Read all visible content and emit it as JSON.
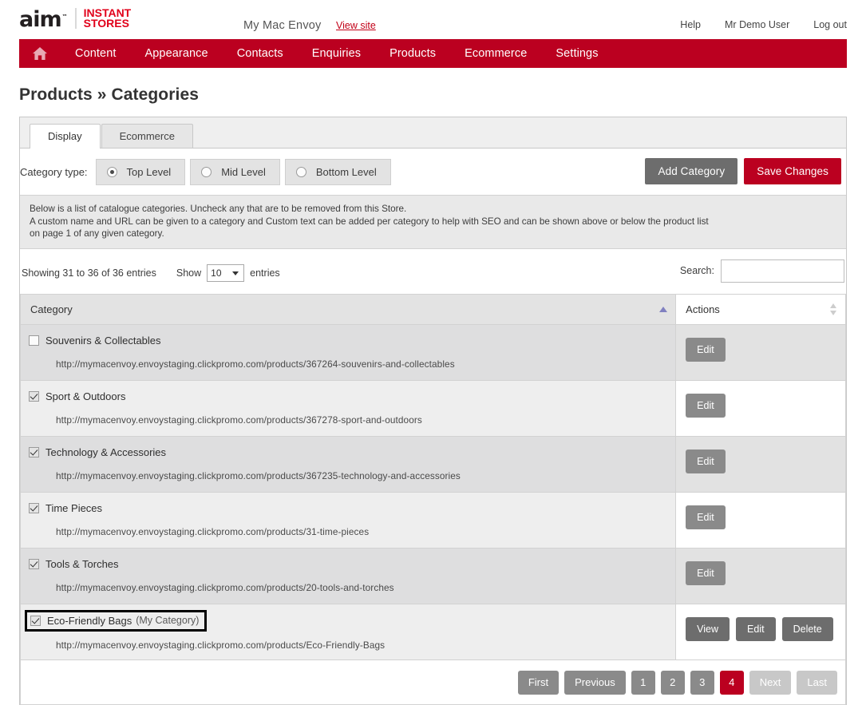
{
  "brand": {
    "logo_primary": "aim",
    "logo_tm": "™",
    "logo_secondary_line1": "INSTANT",
    "logo_secondary_line2": "STORES",
    "accent_red": "#bb0020",
    "logo_red": "#e1001a"
  },
  "topbar": {
    "site_name": "My Mac Envoy",
    "view_site": "View site",
    "links": [
      {
        "label": "Help"
      },
      {
        "label": "Mr Demo User"
      },
      {
        "label": "Log out"
      }
    ]
  },
  "nav": {
    "home_icon": "home-icon",
    "items": [
      {
        "label": "Content"
      },
      {
        "label": "Appearance"
      },
      {
        "label": "Contacts"
      },
      {
        "label": "Enquiries"
      },
      {
        "label": "Products"
      },
      {
        "label": "Ecommerce"
      },
      {
        "label": "Settings"
      }
    ]
  },
  "page": {
    "title": "Products » Categories"
  },
  "tabs": [
    {
      "label": "Display",
      "active": true
    },
    {
      "label": "Ecommerce",
      "active": false
    }
  ],
  "category_type": {
    "label": "Category type:",
    "options": [
      {
        "label": "Top Level",
        "selected": true
      },
      {
        "label": "Mid Level",
        "selected": false
      },
      {
        "label": "Bottom Level",
        "selected": false
      }
    ]
  },
  "toolbar": {
    "add_category_label": "Add Category",
    "save_changes_label": "Save Changes"
  },
  "info": {
    "line1": "Below is a list of catalogue categories. Uncheck any that are to be removed from this Store.",
    "line2": "A custom name and URL can be given to a category and Custom text can be added per category to help with SEO and can be shown above or below the product list",
    "line3": "on page 1 of any given category."
  },
  "table_meta": {
    "showing": "Showing 31 to 36 of 36 entries",
    "show_label": "Show",
    "entries_label": "entries",
    "page_size": "10",
    "search_label": "Search:",
    "search_value": "",
    "search_placeholder": ""
  },
  "table": {
    "headers": [
      {
        "label": "Category",
        "sort": "asc"
      },
      {
        "label": "Actions",
        "sort": "none"
      }
    ],
    "rows": [
      {
        "checked": false,
        "name": "Souvenirs & Collectables",
        "custom_name": "",
        "highlighted": false,
        "url": "http://mymacenvoy.envoystaging.clickpromo.com/products/367264-souvenirs-and-collectables",
        "actions": [
          {
            "label": "Edit",
            "style": "grey"
          }
        ]
      },
      {
        "checked": true,
        "name": "Sport & Outdoors",
        "custom_name": "",
        "highlighted": false,
        "url": "http://mymacenvoy.envoystaging.clickpromo.com/products/367278-sport-and-outdoors",
        "actions": [
          {
            "label": "Edit",
            "style": "grey"
          }
        ]
      },
      {
        "checked": true,
        "name": "Technology & Accessories",
        "custom_name": "",
        "highlighted": false,
        "url": "http://mymacenvoy.envoystaging.clickpromo.com/products/367235-technology-and-accessories",
        "actions": [
          {
            "label": "Edit",
            "style": "grey"
          }
        ]
      },
      {
        "checked": true,
        "name": "Time Pieces",
        "custom_name": "",
        "highlighted": false,
        "url": "http://mymacenvoy.envoystaging.clickpromo.com/products/31-time-pieces",
        "actions": [
          {
            "label": "Edit",
            "style": "grey"
          }
        ]
      },
      {
        "checked": true,
        "name": "Tools & Torches",
        "custom_name": "",
        "highlighted": false,
        "url": "http://mymacenvoy.envoystaging.clickpromo.com/products/20-tools-and-torches",
        "actions": [
          {
            "label": "Edit",
            "style": "grey"
          }
        ]
      },
      {
        "checked": true,
        "name": "Eco-Friendly Bags",
        "custom_name": "(My Category)",
        "highlighted": true,
        "url": "http://mymacenvoy.envoystaging.clickpromo.com/products/Eco-Friendly-Bags",
        "actions": [
          {
            "label": "View",
            "style": "dark"
          },
          {
            "label": "Edit",
            "style": "dark"
          },
          {
            "label": "Delete",
            "style": "dark"
          }
        ]
      }
    ]
  },
  "pagination": {
    "buttons": [
      {
        "label": "First",
        "state": "normal"
      },
      {
        "label": "Previous",
        "state": "normal"
      },
      {
        "label": "1",
        "state": "normal",
        "num": true
      },
      {
        "label": "2",
        "state": "normal",
        "num": true
      },
      {
        "label": "3",
        "state": "normal",
        "num": true
      },
      {
        "label": "4",
        "state": "active",
        "num": true
      },
      {
        "label": "Next",
        "state": "disabled"
      },
      {
        "label": "Last",
        "state": "disabled"
      }
    ]
  }
}
